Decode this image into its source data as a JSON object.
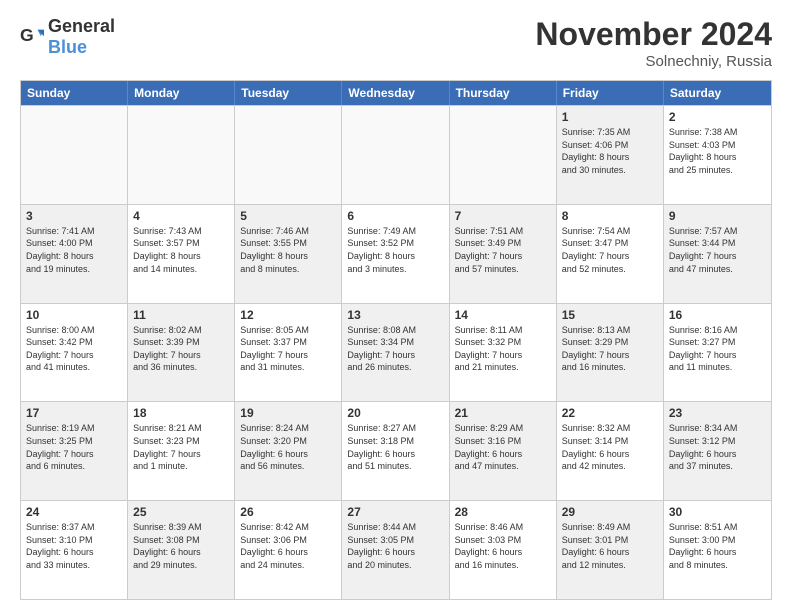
{
  "logo": {
    "general": "General",
    "blue": "Blue"
  },
  "title": "November 2024",
  "location": "Solnechniy, Russia",
  "days_of_week": [
    "Sunday",
    "Monday",
    "Tuesday",
    "Wednesday",
    "Thursday",
    "Friday",
    "Saturday"
  ],
  "weeks": [
    [
      {
        "day": "",
        "info": "",
        "empty": true
      },
      {
        "day": "",
        "info": "",
        "empty": true
      },
      {
        "day": "",
        "info": "",
        "empty": true
      },
      {
        "day": "",
        "info": "",
        "empty": true
      },
      {
        "day": "",
        "info": "",
        "empty": true
      },
      {
        "day": "1",
        "info": "Sunrise: 7:35 AM\nSunset: 4:06 PM\nDaylight: 8 hours\nand 30 minutes.",
        "shaded": true
      },
      {
        "day": "2",
        "info": "Sunrise: 7:38 AM\nSunset: 4:03 PM\nDaylight: 8 hours\nand 25 minutes.",
        "shaded": false
      }
    ],
    [
      {
        "day": "3",
        "info": "Sunrise: 7:41 AM\nSunset: 4:00 PM\nDaylight: 8 hours\nand 19 minutes.",
        "shaded": true
      },
      {
        "day": "4",
        "info": "Sunrise: 7:43 AM\nSunset: 3:57 PM\nDaylight: 8 hours\nand 14 minutes.",
        "shaded": false
      },
      {
        "day": "5",
        "info": "Sunrise: 7:46 AM\nSunset: 3:55 PM\nDaylight: 8 hours\nand 8 minutes.",
        "shaded": true
      },
      {
        "day": "6",
        "info": "Sunrise: 7:49 AM\nSunset: 3:52 PM\nDaylight: 8 hours\nand 3 minutes.",
        "shaded": false
      },
      {
        "day": "7",
        "info": "Sunrise: 7:51 AM\nSunset: 3:49 PM\nDaylight: 7 hours\nand 57 minutes.",
        "shaded": true
      },
      {
        "day": "8",
        "info": "Sunrise: 7:54 AM\nSunset: 3:47 PM\nDaylight: 7 hours\nand 52 minutes.",
        "shaded": false
      },
      {
        "day": "9",
        "info": "Sunrise: 7:57 AM\nSunset: 3:44 PM\nDaylight: 7 hours\nand 47 minutes.",
        "shaded": true
      }
    ],
    [
      {
        "day": "10",
        "info": "Sunrise: 8:00 AM\nSunset: 3:42 PM\nDaylight: 7 hours\nand 41 minutes.",
        "shaded": false
      },
      {
        "day": "11",
        "info": "Sunrise: 8:02 AM\nSunset: 3:39 PM\nDaylight: 7 hours\nand 36 minutes.",
        "shaded": true
      },
      {
        "day": "12",
        "info": "Sunrise: 8:05 AM\nSunset: 3:37 PM\nDaylight: 7 hours\nand 31 minutes.",
        "shaded": false
      },
      {
        "day": "13",
        "info": "Sunrise: 8:08 AM\nSunset: 3:34 PM\nDaylight: 7 hours\nand 26 minutes.",
        "shaded": true
      },
      {
        "day": "14",
        "info": "Sunrise: 8:11 AM\nSunset: 3:32 PM\nDaylight: 7 hours\nand 21 minutes.",
        "shaded": false
      },
      {
        "day": "15",
        "info": "Sunrise: 8:13 AM\nSunset: 3:29 PM\nDaylight: 7 hours\nand 16 minutes.",
        "shaded": true
      },
      {
        "day": "16",
        "info": "Sunrise: 8:16 AM\nSunset: 3:27 PM\nDaylight: 7 hours\nand 11 minutes.",
        "shaded": false
      }
    ],
    [
      {
        "day": "17",
        "info": "Sunrise: 8:19 AM\nSunset: 3:25 PM\nDaylight: 7 hours\nand 6 minutes.",
        "shaded": true
      },
      {
        "day": "18",
        "info": "Sunrise: 8:21 AM\nSunset: 3:23 PM\nDaylight: 7 hours\nand 1 minute.",
        "shaded": false
      },
      {
        "day": "19",
        "info": "Sunrise: 8:24 AM\nSunset: 3:20 PM\nDaylight: 6 hours\nand 56 minutes.",
        "shaded": true
      },
      {
        "day": "20",
        "info": "Sunrise: 8:27 AM\nSunset: 3:18 PM\nDaylight: 6 hours\nand 51 minutes.",
        "shaded": false
      },
      {
        "day": "21",
        "info": "Sunrise: 8:29 AM\nSunset: 3:16 PM\nDaylight: 6 hours\nand 47 minutes.",
        "shaded": true
      },
      {
        "day": "22",
        "info": "Sunrise: 8:32 AM\nSunset: 3:14 PM\nDaylight: 6 hours\nand 42 minutes.",
        "shaded": false
      },
      {
        "day": "23",
        "info": "Sunrise: 8:34 AM\nSunset: 3:12 PM\nDaylight: 6 hours\nand 37 minutes.",
        "shaded": true
      }
    ],
    [
      {
        "day": "24",
        "info": "Sunrise: 8:37 AM\nSunset: 3:10 PM\nDaylight: 6 hours\nand 33 minutes.",
        "shaded": false
      },
      {
        "day": "25",
        "info": "Sunrise: 8:39 AM\nSunset: 3:08 PM\nDaylight: 6 hours\nand 29 minutes.",
        "shaded": true
      },
      {
        "day": "26",
        "info": "Sunrise: 8:42 AM\nSunset: 3:06 PM\nDaylight: 6 hours\nand 24 minutes.",
        "shaded": false
      },
      {
        "day": "27",
        "info": "Sunrise: 8:44 AM\nSunset: 3:05 PM\nDaylight: 6 hours\nand 20 minutes.",
        "shaded": true
      },
      {
        "day": "28",
        "info": "Sunrise: 8:46 AM\nSunset: 3:03 PM\nDaylight: 6 hours\nand 16 minutes.",
        "shaded": false
      },
      {
        "day": "29",
        "info": "Sunrise: 8:49 AM\nSunset: 3:01 PM\nDaylight: 6 hours\nand 12 minutes.",
        "shaded": true
      },
      {
        "day": "30",
        "info": "Sunrise: 8:51 AM\nSunset: 3:00 PM\nDaylight: 6 hours\nand 8 minutes.",
        "shaded": false
      }
    ]
  ]
}
